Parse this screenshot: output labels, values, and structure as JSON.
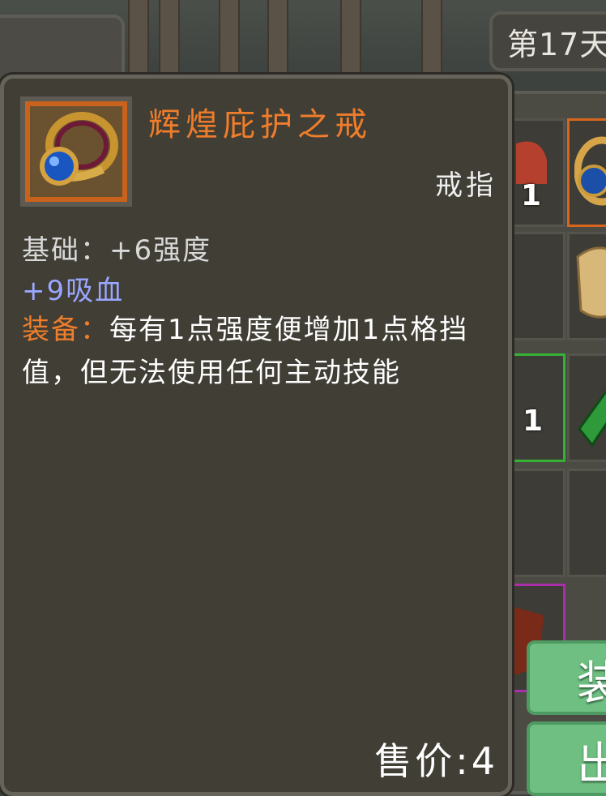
{
  "hud": {
    "day_label": "第17天"
  },
  "item": {
    "name": "辉煌庇护之戒",
    "type": "戒指",
    "icon": "gold-ring-blue-gem-icon",
    "rarity_color": "#c9621c",
    "base_stat": "基础：+6强度",
    "bonus_stat": "+9吸血",
    "equip_label": "装备：",
    "equip_text": "每有1点强度便增加1点格挡值，但无法使用任何主动技能",
    "price": "售价:4"
  },
  "inventory": {
    "slots": [
      {
        "icon": "potion-icon",
        "count": "1",
        "quality": "none"
      },
      {
        "icon": "gold-ring-icon",
        "count": "",
        "quality": "orange"
      },
      {
        "icon": "empty",
        "count": "",
        "quality": "none"
      },
      {
        "icon": "scroll-icon",
        "count": "",
        "quality": "none"
      },
      {
        "icon": "empty",
        "count": "1",
        "quality": "green"
      },
      {
        "icon": "green-crystal-icon",
        "count": "",
        "quality": "none"
      },
      {
        "icon": "empty",
        "count": "",
        "quality": "none"
      },
      {
        "icon": "empty",
        "count": "",
        "quality": "none"
      },
      {
        "icon": "red-shield-icon",
        "count": "",
        "quality": "purple"
      }
    ]
  },
  "buttons": {
    "equip": "装",
    "sell": "出"
  }
}
